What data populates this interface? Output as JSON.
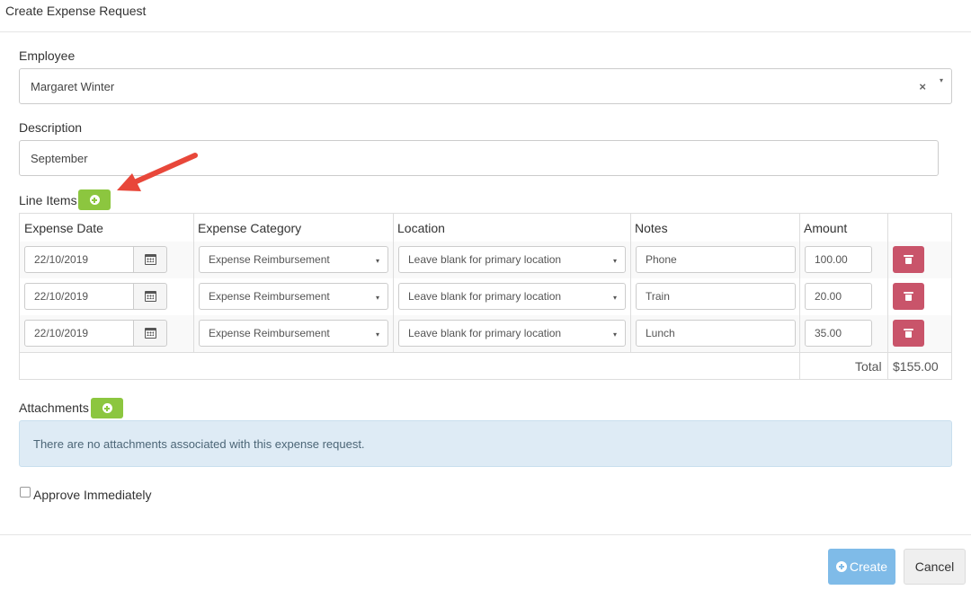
{
  "modal": {
    "title": "Create Expense Request"
  },
  "employee": {
    "label": "Employee",
    "value": "Margaret Winter",
    "clear": "×",
    "caret": "▾"
  },
  "description": {
    "label": "Description",
    "value": "September"
  },
  "line_items": {
    "label": "Line Items",
    "headers": [
      "Expense Date",
      "Expense Category",
      "Location",
      "Notes",
      "Amount"
    ],
    "rows": [
      {
        "date": "22/10/2019",
        "category": "Expense Reimbursement",
        "location": "Leave blank for primary location",
        "notes": "Phone",
        "amount": "100.00"
      },
      {
        "date": "22/10/2019",
        "category": "Expense Reimbursement",
        "location": "Leave blank for primary location",
        "notes": "Train",
        "amount": "20.00"
      },
      {
        "date": "22/10/2019",
        "category": "Expense Reimbursement",
        "location": "Leave blank for primary location",
        "notes": "Lunch",
        "amount": "35.00"
      }
    ],
    "total_label": "Total",
    "total_value": "$155.00",
    "caret": "▾"
  },
  "attachments": {
    "label": "Attachments",
    "empty_message": "There are no attachments associated with this expense request."
  },
  "approve": {
    "label": "Approve Immediately"
  },
  "footer": {
    "create_label": "Create",
    "cancel_label": "Cancel"
  },
  "icons": {
    "add_line_item": "plus-circle-icon",
    "calendar": "calendar-icon",
    "delete": "trash-icon",
    "annotation": "red-arrow-icon"
  },
  "colors": {
    "green_button": "#8cc63f",
    "delete_button": "#c9546a",
    "create_button": "#7fbbe8",
    "info_panel": "#deebf5",
    "arrow": "#e8473a"
  }
}
